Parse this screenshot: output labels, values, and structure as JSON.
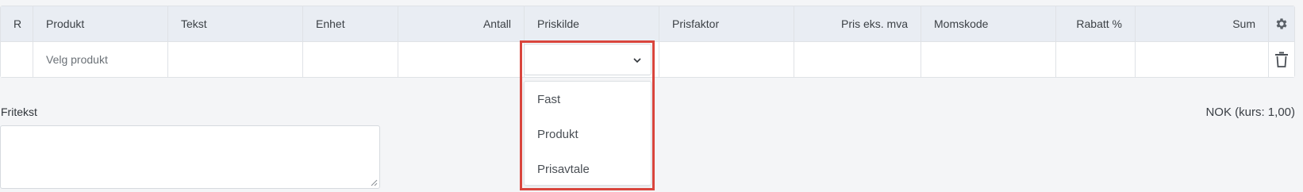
{
  "table": {
    "headers": {
      "r": "R",
      "produkt": "Produkt",
      "tekst": "Tekst",
      "enhet": "Enhet",
      "antall": "Antall",
      "priskilde": "Priskilde",
      "prisfaktor": "Prisfaktor",
      "pris_eks_mva": "Pris eks. mva",
      "momskode": "Momskode",
      "rabatt": "Rabatt %",
      "sum": "Sum"
    },
    "row": {
      "produkt_placeholder": "Velg produkt"
    },
    "settings_icon": "gear-icon",
    "delete_icon": "trash-icon"
  },
  "priskilde_dropdown": {
    "selected": "",
    "options": [
      "Fast",
      "Produkt",
      "Prisavtale"
    ]
  },
  "fritekst": {
    "label": "Fritekst",
    "value": ""
  },
  "currency_text": "NOK (kurs: 1,00)",
  "colors": {
    "header_bg": "#e9edf3",
    "highlight": "#d9453d",
    "page_bg": "#f4f5f7"
  }
}
